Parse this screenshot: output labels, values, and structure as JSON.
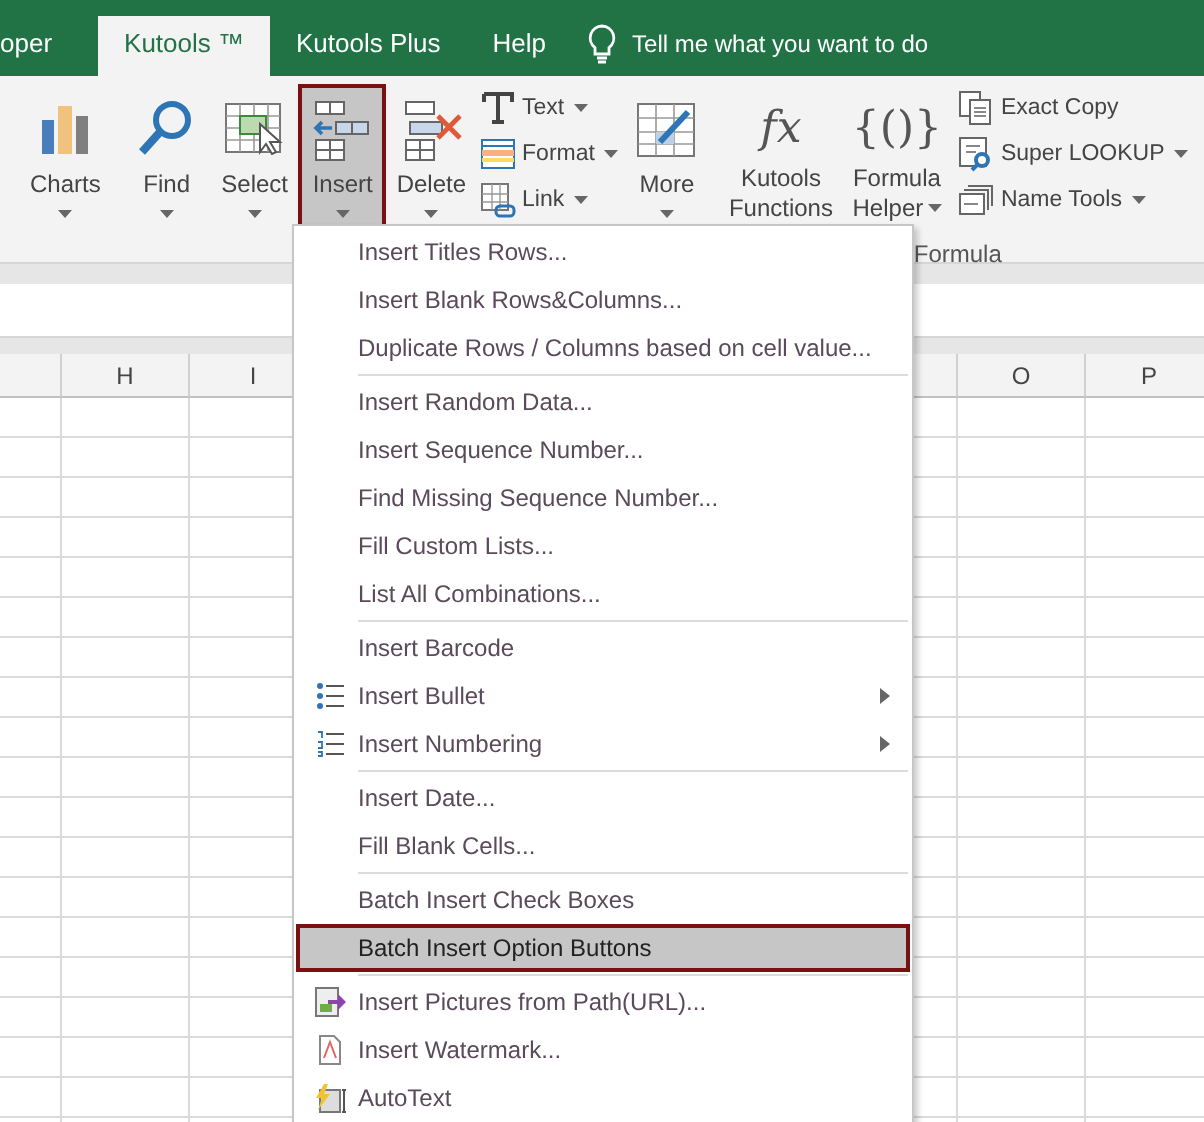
{
  "tabs": [
    {
      "label": "oper",
      "selected": false
    },
    {
      "label": "Kutools ™",
      "selected": true
    },
    {
      "label": "Kutools Plus",
      "selected": false
    },
    {
      "label": "Help",
      "selected": false
    }
  ],
  "tell_me": {
    "placeholder": "Tell me what you want to do"
  },
  "ribbon": [
    {
      "items": [
        {
          "kind": "large",
          "label": "Charts",
          "selected": false
        }
      ]
    },
    {
      "items": [
        {
          "kind": "large",
          "label": "Find",
          "selected": false
        },
        {
          "kind": "large",
          "label": "Select",
          "selected": false
        },
        {
          "kind": "large",
          "label": "Insert",
          "selected": true
        },
        {
          "kind": "large",
          "label": "Delete",
          "selected": false
        },
        {
          "kind": "stack",
          "buttons": [
            {
              "label": "Text",
              "dropdown": true
            },
            {
              "label": "Format",
              "dropdown": true
            },
            {
              "label": "Link",
              "dropdown": true
            }
          ]
        },
        {
          "kind": "large",
          "label": "More",
          "selected": false
        }
      ]
    },
    {
      "label": "Formula",
      "items": [
        {
          "kind": "glyph",
          "glyph": "fx",
          "label": "Kutools Functions",
          "selected": false
        },
        {
          "kind": "glyph",
          "glyph": "{()}",
          "label": "Formula Helper",
          "selected": false
        },
        {
          "kind": "stack",
          "buttons": [
            {
              "label": "Exact Copy",
              "dropdown": false
            },
            {
              "label": "Super LOOKUP",
              "dropdown": true
            },
            {
              "label": "Name Tools",
              "dropdown": true
            }
          ]
        }
      ]
    }
  ],
  "columns": [
    "",
    "H",
    "I",
    "",
    "",
    "",
    "",
    "",
    "O",
    "P"
  ],
  "menu": [
    [
      {
        "label": "Insert Titles Rows...",
        "submenu": false,
        "selected": false
      },
      {
        "label": "Insert Blank Rows&Columns...",
        "submenu": false,
        "selected": false
      },
      {
        "label": "Duplicate Rows / Columns based on cell value...",
        "submenu": false,
        "selected": false
      }
    ],
    [
      {
        "label": "Insert Random Data...",
        "submenu": false,
        "selected": false
      },
      {
        "label": "Insert Sequence Number...",
        "submenu": false,
        "selected": false
      },
      {
        "label": "Find Missing Sequence Number...",
        "submenu": false,
        "selected": false
      },
      {
        "label": "Fill Custom Lists...",
        "submenu": false,
        "selected": false
      },
      {
        "label": "List All Combinations...",
        "submenu": false,
        "selected": false
      }
    ],
    [
      {
        "label": "Insert Barcode",
        "submenu": false,
        "selected": false
      },
      {
        "label": "Insert Bullet",
        "submenu": true,
        "selected": false
      },
      {
        "label": "Insert Numbering",
        "submenu": true,
        "selected": false
      }
    ],
    [
      {
        "label": "Insert Date...",
        "submenu": false,
        "selected": false
      },
      {
        "label": "Fill Blank Cells...",
        "submenu": false,
        "selected": false
      }
    ],
    [
      {
        "label": "Batch Insert Check Boxes",
        "submenu": false,
        "selected": false
      },
      {
        "label": "Batch Insert Option Buttons",
        "submenu": false,
        "selected": true
      }
    ],
    [
      {
        "label": "Insert Pictures from Path(URL)...",
        "submenu": false,
        "selected": false
      },
      {
        "label": "Insert Watermark...",
        "submenu": false,
        "selected": false
      },
      {
        "label": "AutoText",
        "submenu": false,
        "selected": false
      }
    ]
  ]
}
